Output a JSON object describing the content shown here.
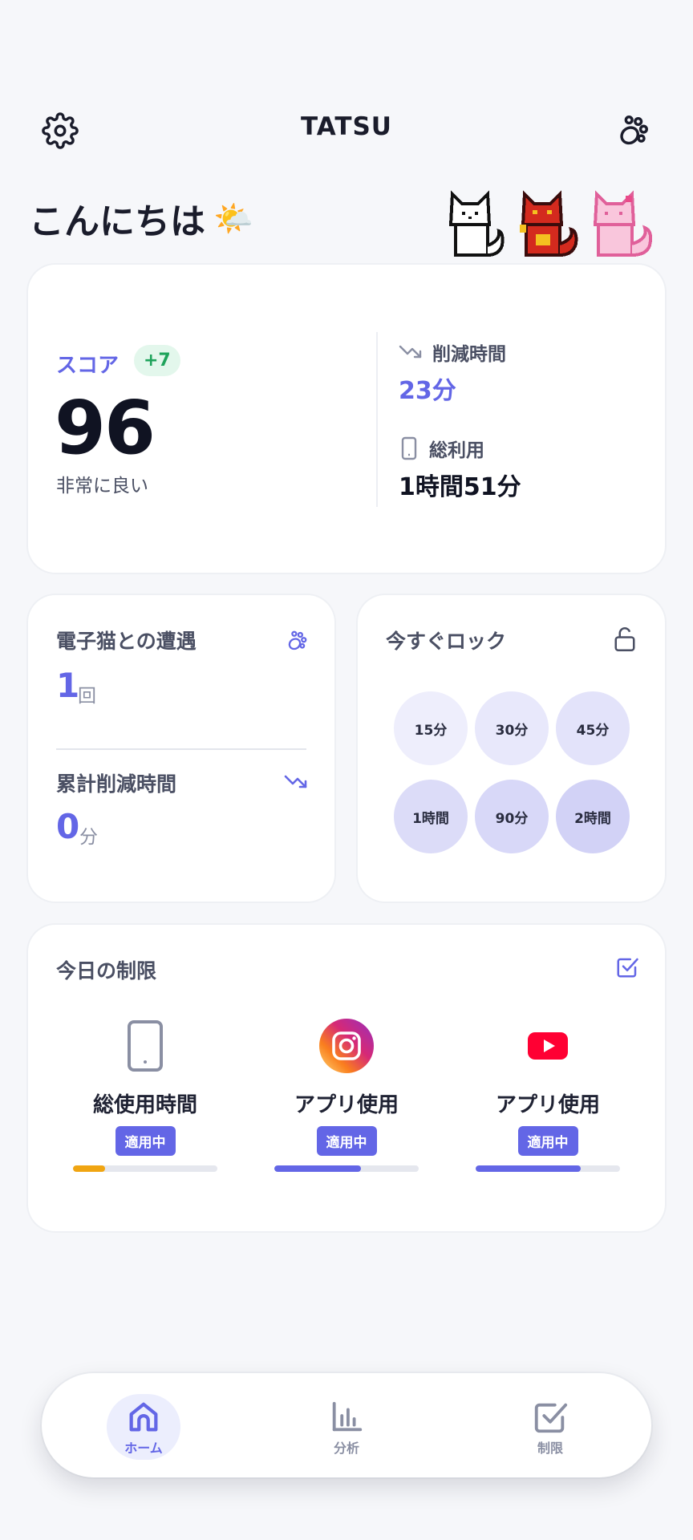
{
  "header": {
    "title": "TATSU",
    "settings_icon": "gear-icon",
    "paw_icon": "paw-icon"
  },
  "greeting": {
    "text": "こんにちは",
    "emoji": "🌤️"
  },
  "score_card": {
    "label": "スコア",
    "delta": "+7",
    "value": "96",
    "description": "非常に良い",
    "reduced_label": "削減時間",
    "reduced_value": "23分",
    "total_label": "総利用",
    "total_value": "1時間51分"
  },
  "encounter_card": {
    "title": "電子猫との遭遇",
    "count": "1",
    "count_unit": "回",
    "cumulative_title": "累計削減時間",
    "cumulative_value": "0",
    "cumulative_unit": "分"
  },
  "lock_card": {
    "title": "今すぐロック",
    "options": [
      "15分",
      "30分",
      "45分",
      "1時間",
      "90分",
      "2時間"
    ]
  },
  "limits_card": {
    "title": "今日の制限",
    "items": [
      {
        "label": "総使用時間",
        "badge": "適用中",
        "icon": "phone-icon",
        "progress": 0.22,
        "color": "#f0a512"
      },
      {
        "label": "アプリ使用",
        "badge": "適用中",
        "icon": "instagram-icon",
        "progress": 0.6,
        "color": "#6366e6"
      },
      {
        "label": "アプリ使用",
        "badge": "適用中",
        "icon": "youtube-icon",
        "progress": 0.73,
        "color": "#6366e6"
      }
    ]
  },
  "nav": {
    "items": [
      {
        "label": "ホーム",
        "icon": "home-icon",
        "active": true
      },
      {
        "label": "分析",
        "icon": "chart-icon",
        "active": false
      },
      {
        "label": "制限",
        "icon": "checkbox-icon",
        "active": false
      }
    ]
  },
  "colors": {
    "accent": "#6366e6",
    "positive": "#1ea35b",
    "warning": "#f0a512",
    "background": "#f6f7fa"
  }
}
